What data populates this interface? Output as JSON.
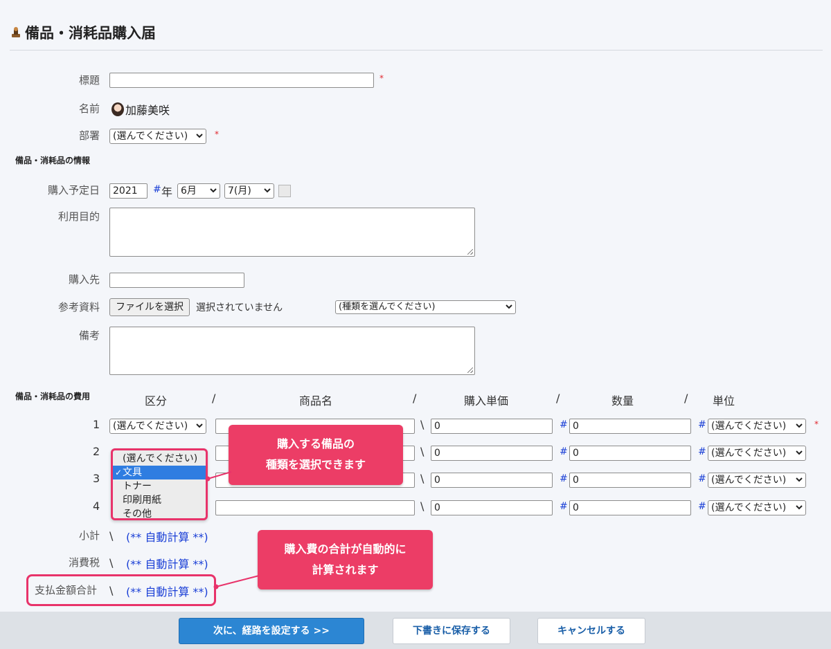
{
  "page": {
    "title": "備品・消耗品購入届"
  },
  "form": {
    "title_label": "標題",
    "required_mark": "*",
    "name_label": "名前",
    "name_value": "加藤美咲",
    "dept_label": "部署",
    "dept_value": "(選んでください)",
    "section_info": "備品・消耗品の情報",
    "date_label": "購入予定日",
    "year_value": "2021",
    "year_suffix": "年",
    "hash": "#",
    "month_value": "6月",
    "day_value": "7(月)",
    "purpose_label": "利用目的",
    "vendor_label": "購入先",
    "ref_label": "参考資料",
    "file_button": "ファイルを選択",
    "file_status": "選択されていません",
    "ref_type_value": "(種類を選んでください)",
    "notes_label": "備考"
  },
  "costs": {
    "section_label": "備品・消耗品の費用",
    "headers": {
      "category": "区分",
      "product": "商品名",
      "unit_price": "購入単価",
      "quantity": "数量",
      "unit": "単位",
      "sep": "/"
    },
    "yen": "\\",
    "rows": [
      {
        "no": "1",
        "category": "(選んでください)",
        "price": "0",
        "qty": "0",
        "unit": "(選んでください)"
      },
      {
        "no": "2",
        "category": "",
        "price": "0",
        "qty": "0",
        "unit": "(選んでください)"
      },
      {
        "no": "3",
        "category": "",
        "price": "0",
        "qty": "0",
        "unit": "(選んでください)"
      },
      {
        "no": "4",
        "category": "",
        "price": "0",
        "qty": "0",
        "unit": "(選んでください)"
      }
    ],
    "dropdown_options": [
      "(選んでください)",
      "文具",
      "トナー",
      "印刷用紙",
      "その他"
    ],
    "dropdown_selected": "文具",
    "check": "✓",
    "subtotal_label": "小計",
    "tax_label": "消費税",
    "total_label": "支払金額合計",
    "auto_calc": "(** 自動計算 **)"
  },
  "callouts": {
    "category": [
      "購入する備品の",
      "種類を選択できます"
    ],
    "total": [
      "購入費の合計が自動的に",
      "計算されます"
    ]
  },
  "buttons": {
    "next": "次に、経路を設定する >>",
    "draft": "下書きに保存する",
    "cancel": "キャンセルする"
  },
  "colors": {
    "accent": "#e8336a",
    "link_blue": "#1a3fd6",
    "primary_button": "#2c86d3"
  }
}
